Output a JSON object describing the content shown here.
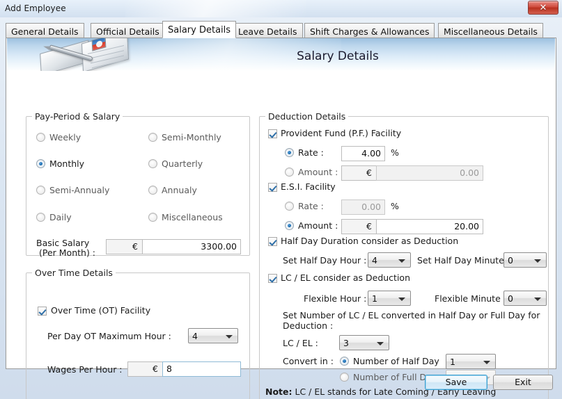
{
  "window": {
    "title": "Add Employee",
    "close_label": "✕"
  },
  "tabs": [
    {
      "label": "General Details",
      "active": false
    },
    {
      "label": "Official Details",
      "active": false
    },
    {
      "label": "Salary Details",
      "active": true
    },
    {
      "label": "Leave Details",
      "active": false
    },
    {
      "label": "Shift Charges & Allowances",
      "active": false
    },
    {
      "label": "Miscellaneous Details",
      "active": false
    }
  ],
  "banner": {
    "page_title": "Salary Details",
    "icon": "notepad-pen-icon"
  },
  "pay_period": {
    "legend": "Pay-Period & Salary",
    "options": [
      {
        "label": "Weekly",
        "selected": false
      },
      {
        "label": "Semi-Monthly",
        "selected": false
      },
      {
        "label": "Monthly",
        "selected": true
      },
      {
        "label": "Quarterly",
        "selected": false
      },
      {
        "label": "Semi-Annualy",
        "selected": false
      },
      {
        "label": "Annualy",
        "selected": false
      },
      {
        "label": "Daily",
        "selected": false
      },
      {
        "label": "Miscellaneous",
        "selected": false
      }
    ],
    "basic_salary_label_line1": "Basic Salary",
    "basic_salary_label_line2": "(Per Month) :",
    "currency": "€",
    "basic_salary_value": "3300.00"
  },
  "over_time": {
    "legend": "Over Time Details",
    "facility_label": "Over Time (OT) Facility",
    "facility_checked": true,
    "max_hour_label": "Per Day OT Maximum Hour :",
    "max_hour_value": "4",
    "wages_label": "Wages Per Hour :",
    "currency": "€",
    "wages_value": "8"
  },
  "deduction": {
    "legend": "Deduction Details",
    "pf": {
      "facility_label": "Provident Fund (P.F.) Facility",
      "facility_checked": true,
      "rate_label": "Rate :",
      "rate_selected": true,
      "rate_value": "4.00",
      "percent": "%",
      "amount_label": "Amount :",
      "amount_selected": false,
      "currency": "€",
      "amount_value": "0.00"
    },
    "esi": {
      "facility_label": "E.S.I. Facility",
      "facility_checked": true,
      "rate_label": "Rate :",
      "rate_selected": false,
      "rate_value": "0.00",
      "percent": "%",
      "amount_label": "Amount :",
      "amount_selected": true,
      "currency": "€",
      "amount_value": "20.00"
    },
    "half_day": {
      "facility_label": "Half Day Duration consider as Deduction",
      "facility_checked": true,
      "hour_label": "Set Half Day Hour :",
      "hour_value": "4",
      "minute_label": "Set Half Day Minute :",
      "minute_value": "0"
    },
    "lcel": {
      "facility_label": "LC / EL consider as Deduction",
      "facility_checked": true,
      "flex_hour_label": "Flexible Hour :",
      "flex_hour_value": "1",
      "flex_minute_label": "Flexible Minute :",
      "flex_minute_value": "0",
      "instruction_line1": "Set Number of LC / EL converted in Half Day or Full Day for",
      "instruction_line2": "Deduction :",
      "count_label": "LC / EL :",
      "count_value": "3",
      "convert_label": "Convert in :",
      "half_day_option": "Number of Half Day",
      "half_day_selected": true,
      "half_day_value": "1",
      "full_day_option": "Number of Full Day",
      "full_day_selected": false,
      "full_day_value": ""
    },
    "note_prefix": "Note:",
    "note_text": " LC / EL stands for Late Coming / Early Leaving"
  },
  "footer": {
    "save_label": "Save",
    "exit_label": "Exit"
  }
}
